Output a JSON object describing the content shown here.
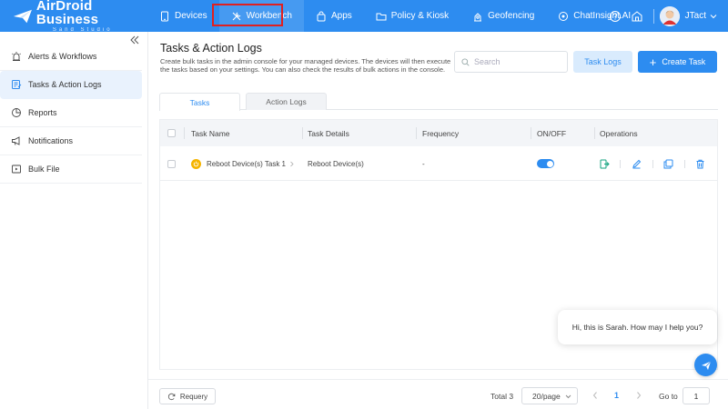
{
  "brand": {
    "title": "AirDroid Business",
    "subtitle": "Sand Studio"
  },
  "nav": [
    {
      "label": "Devices",
      "icon": "tablet-icon"
    },
    {
      "label": "Workbench",
      "icon": "tools-icon",
      "active": true
    },
    {
      "label": "Apps",
      "icon": "apps-icon"
    },
    {
      "label": "Policy & Kiosk",
      "icon": "folder-icon"
    },
    {
      "label": "Geofencing",
      "icon": "geofence-icon"
    },
    {
      "label": "ChatInsight.AI",
      "icon": "chat-ai-icon"
    }
  ],
  "user": {
    "name": "JTact"
  },
  "sidebar": {
    "items": [
      {
        "label": "Alerts & Workflows",
        "icon": "alert-icon"
      },
      {
        "label": "Tasks & Action Logs",
        "icon": "tasks-icon",
        "active": true
      },
      {
        "label": "Reports",
        "icon": "reports-icon"
      },
      {
        "label": "Notifications",
        "icon": "megaphone-icon"
      },
      {
        "label": "Bulk File",
        "icon": "file-icon"
      }
    ]
  },
  "page": {
    "title": "Tasks & Action Logs",
    "description": "Create bulk tasks in the admin console for your managed devices. The devices will then execute the tasks based on your settings. You can also check the results of bulk actions in the console."
  },
  "search": {
    "placeholder": "Search",
    "value": ""
  },
  "buttons": {
    "task_logs": "Task Logs",
    "create_task": "Create Task"
  },
  "tabs": [
    {
      "label": "Tasks",
      "active": true
    },
    {
      "label": "Action Logs"
    }
  ],
  "table": {
    "columns": [
      "Task Name",
      "Task Details",
      "Frequency",
      "ON/OFF",
      "Operations"
    ],
    "rows": [
      {
        "name": "Reboot Device(s) Task 1",
        "details": "Reboot Device(s)",
        "frequency": "-",
        "on": true
      }
    ]
  },
  "footer": {
    "requery": "Requery",
    "total": "Total 3",
    "page_size": "20/page",
    "current_page": "1",
    "goto_label": "Go to",
    "goto_value": "1"
  },
  "chat": {
    "message": "Hi, this is Sarah. How may I help you?"
  },
  "colors": {
    "primary": "#2d8cf0",
    "highlight_box": "#e02020",
    "power_icon": "#f5b400"
  }
}
